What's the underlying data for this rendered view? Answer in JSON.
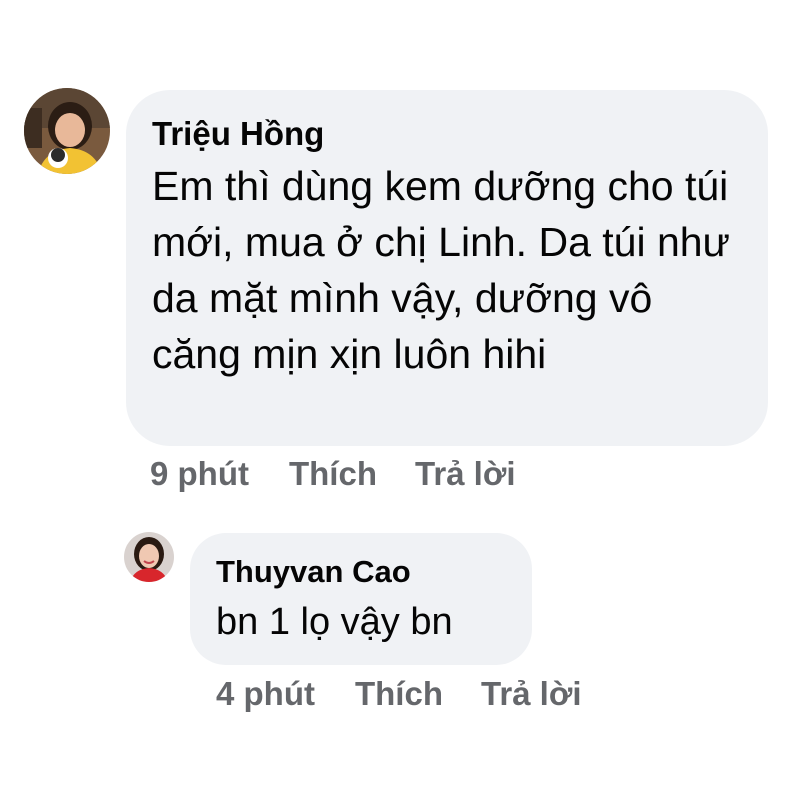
{
  "comments": [
    {
      "author": "Triệu Hồng",
      "text": "Em thì dùng kem dưỡng cho túi mới, mua ở chị Linh. Da túi như da mặt mình vậy, dưỡng vô căng mịn xịn luôn hihi",
      "time": "9 phút",
      "like_label": "Thích",
      "reply_label": "Trả lời"
    },
    {
      "author": "Thuyvan Cao",
      "text": "bn 1 lọ vậy bn",
      "time": "4 phút",
      "like_label": "Thích",
      "reply_label": "Trả lời"
    }
  ],
  "colors": {
    "bubble": "#f0f2f5",
    "text": "#050505",
    "meta": "#65676b"
  }
}
